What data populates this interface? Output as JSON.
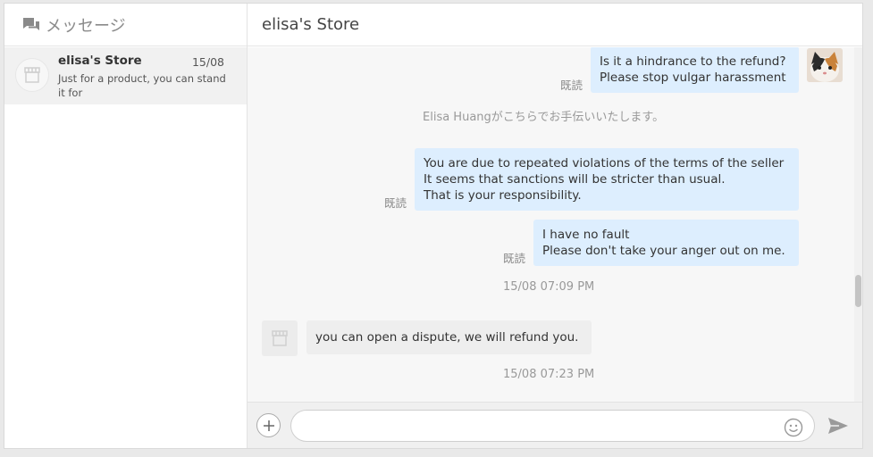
{
  "sidebar": {
    "title": "メッセージ",
    "icon": "chat-bubbles-icon",
    "conversations": [
      {
        "name": "elisa's Store",
        "date": "15/08",
        "preview": "Just for a product, you can stand it for",
        "avatar_icon": "store-icon"
      }
    ]
  },
  "main": {
    "title": "elisa's Store",
    "read_label": "既読",
    "messages": [
      {
        "direction": "out",
        "lines": [
          "Is it a hindrance to the refund?",
          "Please stop vulgar harassment"
        ],
        "read": "既読"
      },
      {
        "type": "system",
        "text": "Elisa Huangがこちらでお手伝いいたします。"
      },
      {
        "direction": "out",
        "lines": [
          "You are due to repeated violations of the terms of the seller",
          "It seems that sanctions will be stricter than usual.",
          "That is your responsibility."
        ],
        "read": "既読"
      },
      {
        "direction": "out",
        "lines": [
          "I have no fault",
          "Please don't take your anger out on me."
        ],
        "read": "既読"
      },
      {
        "type": "timestamp",
        "text": "15/08 07:09 PM"
      },
      {
        "direction": "in",
        "lines": [
          "you can open a dispute, we will refund you."
        ]
      },
      {
        "type": "timestamp",
        "text": "15/08 07:23 PM"
      }
    ]
  },
  "composer": {
    "value": "",
    "placeholder": "",
    "plus_icon": "plus-icon",
    "emoji_icon": "smiley-icon",
    "send_icon": "send-icon"
  },
  "colors": {
    "outgoing_bubble": "#ddeefe",
    "incoming_bubble": "#eeeeee",
    "selected_conversation": "#f1f1f1"
  }
}
